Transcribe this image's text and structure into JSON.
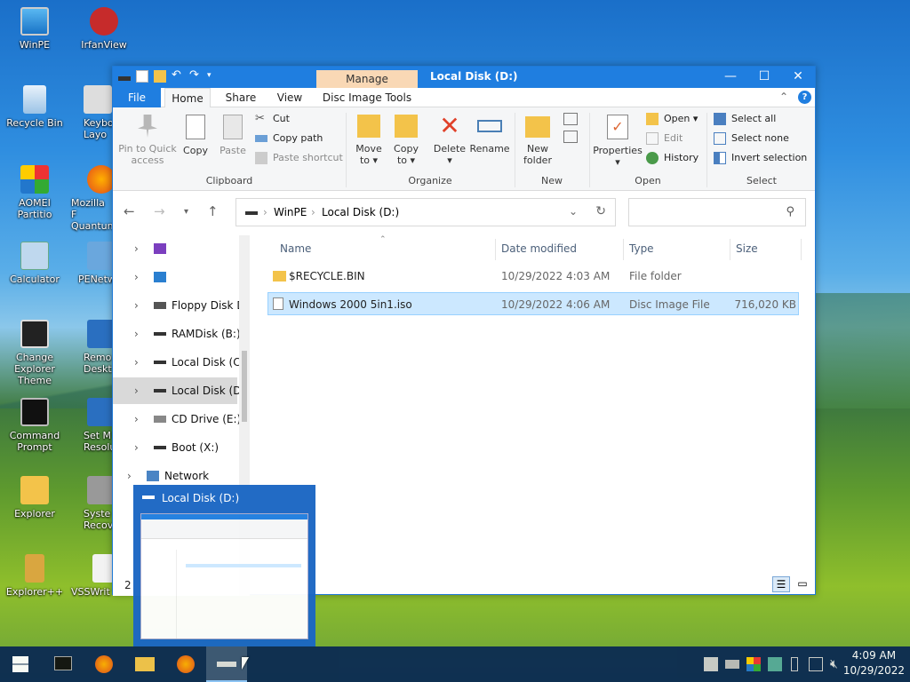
{
  "desktop_icons": [
    {
      "id": "winpe",
      "label": "WinPE"
    },
    {
      "id": "irfanview",
      "label": "IrfanView"
    },
    {
      "id": "recycle",
      "label": "Recycle Bin"
    },
    {
      "id": "keyboard",
      "label": "Keybo Layo"
    },
    {
      "id": "aomei",
      "label": "AOMEI Partitio"
    },
    {
      "id": "firefox",
      "label": "Mozilla F Quantum"
    },
    {
      "id": "calculator",
      "label": "Calculator"
    },
    {
      "id": "penet",
      "label": "PENetw"
    },
    {
      "id": "theme",
      "label": "Change Explorer Theme"
    },
    {
      "id": "remote",
      "label": "Remo Deskt"
    },
    {
      "id": "cmd",
      "label": "Command Prompt"
    },
    {
      "id": "setres",
      "label": "Set M Resolu"
    },
    {
      "id": "explorer",
      "label": "Explorer"
    },
    {
      "id": "sysrec",
      "label": "Syste Recov"
    },
    {
      "id": "explorerpp",
      "label": "Explorer++"
    },
    {
      "id": "vss",
      "label": "VSSWrit"
    }
  ],
  "window": {
    "title": "Local Disk (D:)",
    "context_tab": "Manage",
    "tabs": {
      "file": "File",
      "home": "Home",
      "share": "Share",
      "view": "View",
      "disc": "Disc Image Tools"
    },
    "ribbon": {
      "clipboard": {
        "pin": "Pin to Quick access",
        "copy": "Copy",
        "paste": "Paste",
        "cut": "Cut",
        "copy_path": "Copy path",
        "paste_shortcut": "Paste shortcut",
        "label": "Clipboard"
      },
      "organize": {
        "move": "Move to",
        "copy_to": "Copy to",
        "delete": "Delete",
        "rename": "Rename",
        "label": "Organize"
      },
      "new": {
        "new_folder": "New folder",
        "label": "New"
      },
      "open": {
        "properties": "Properties",
        "open": "Open",
        "edit": "Edit",
        "history": "History",
        "label": "Open"
      },
      "select": {
        "all": "Select all",
        "none": "Select none",
        "invert": "Invert selection",
        "label": "Select"
      }
    },
    "address": {
      "root": "WinPE",
      "current": "Local Disk (D:)",
      "sep": "›"
    },
    "nav": [
      {
        "label": ""
      },
      {
        "label": ""
      },
      {
        "label": "Floppy Disk Drive (A:)"
      },
      {
        "label": "RAMDisk (B:)"
      },
      {
        "label": "Local Disk (C:)"
      },
      {
        "label": "Local Disk (D:)",
        "selected": true
      },
      {
        "label": "CD Drive (E:)"
      },
      {
        "label": "Boot (X:)"
      },
      {
        "label": "Network"
      }
    ],
    "columns": {
      "name": "Name",
      "date": "Date modified",
      "type": "Type",
      "size": "Size"
    },
    "files": [
      {
        "name": "$RECYCLE.BIN",
        "date": "10/29/2022 4:03 AM",
        "type": "File folder",
        "size": ""
      },
      {
        "name": "Windows 2000 5in1.iso",
        "date": "10/29/2022 4:06 AM",
        "type": "Disc Image File",
        "size": "716,020 KB",
        "selected": true
      }
    ],
    "status_count": "2"
  },
  "preview": {
    "title": "Local Disk (D:)"
  },
  "taskbar": {
    "time": "4:09 AM",
    "date": "10/29/2022"
  },
  "colors": {
    "accent": "#1f7ee0",
    "selection": "#cce8ff",
    "taskbar": "#0b2a52",
    "manage_tab": "#f9d8b5"
  }
}
